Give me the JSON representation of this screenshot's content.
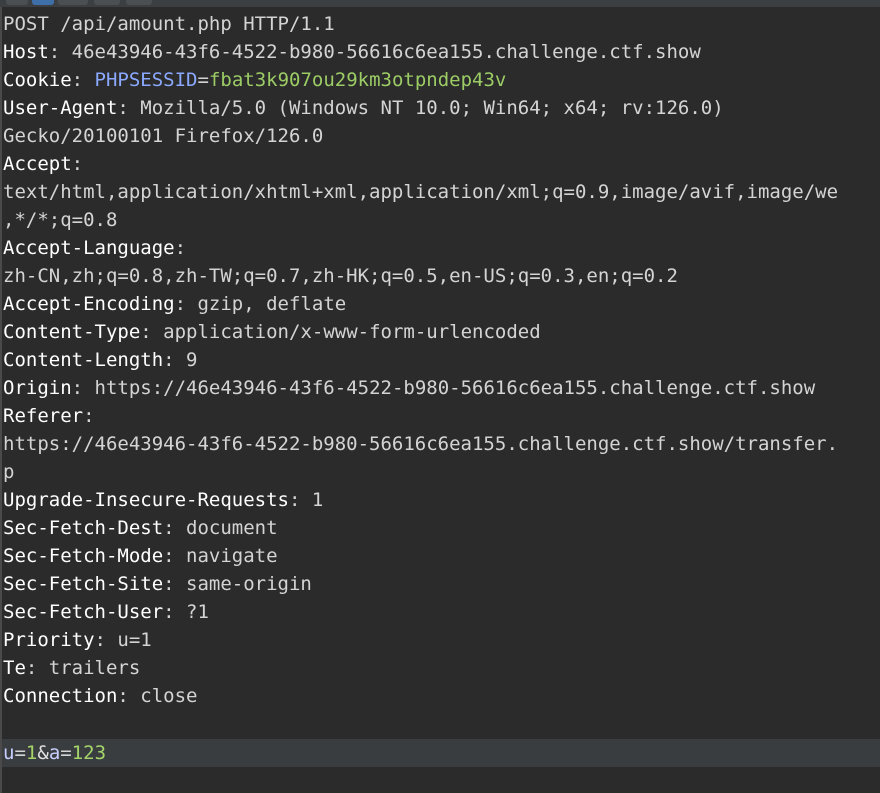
{
  "request_line": "POST /api/amount.php HTTP/1.1",
  "headers": [
    {
      "name": "Host",
      "value": "46e43946-43f6-4522-b980-56616c6ea155.challenge.ctf.show"
    },
    {
      "name": "Cookie",
      "cookie_name": "PHPSESSID",
      "cookie_value": "fbat3k907ou29km3otpndep43v"
    },
    {
      "name": "User-Agent",
      "value": "Mozilla/5.0 (Windows NT 10.0; Win64; x64; rv:126.0)",
      "wrap": "Gecko/20100101 Firefox/126.0"
    },
    {
      "name": "Accept",
      "value": "",
      "wrap": "text/html,application/xhtml+xml,application/xml;q=0.9,image/avif,image/we",
      "wrap2": ",*/*;q=0.8"
    },
    {
      "name": "Accept-Language",
      "value": "",
      "wrap": "zh-CN,zh;q=0.8,zh-TW;q=0.7,zh-HK;q=0.5,en-US;q=0.3,en;q=0.2"
    },
    {
      "name": "Accept-Encoding",
      "value": "gzip, deflate"
    },
    {
      "name": "Content-Type",
      "value": "application/x-www-form-urlencoded"
    },
    {
      "name": "Content-Length",
      "value": "9"
    },
    {
      "name": "Origin",
      "value": "https://46e43946-43f6-4522-b980-56616c6ea155.challenge.ctf.show"
    },
    {
      "name": "Referer",
      "value": "",
      "wrap": "https://46e43946-43f6-4522-b980-56616c6ea155.challenge.ctf.show/transfer.",
      "wrap2": "p"
    },
    {
      "name": "Upgrade-Insecure-Requests",
      "value": "1"
    },
    {
      "name": "Sec-Fetch-Dest",
      "value": "document"
    },
    {
      "name": "Sec-Fetch-Mode",
      "value": "navigate"
    },
    {
      "name": "Sec-Fetch-Site",
      "value": "same-origin"
    },
    {
      "name": "Sec-Fetch-User",
      "value": "?1"
    },
    {
      "name": "Priority",
      "value": "u=1"
    },
    {
      "name": "Te",
      "value": "trailers"
    },
    {
      "name": "Connection",
      "value": "close"
    }
  ],
  "body": {
    "param1_name": "u",
    "param1_value": "1",
    "separator": "&",
    "param2_name": "a",
    "param2_value": "123"
  },
  "colors": {
    "background": "#2b2b2b",
    "header_name": "#ffffff",
    "header_value": "#d4d4d4",
    "cookie_name": "#8aa9ff",
    "cookie_value": "#9ccc65",
    "body_highlight": "#3a3d40"
  }
}
